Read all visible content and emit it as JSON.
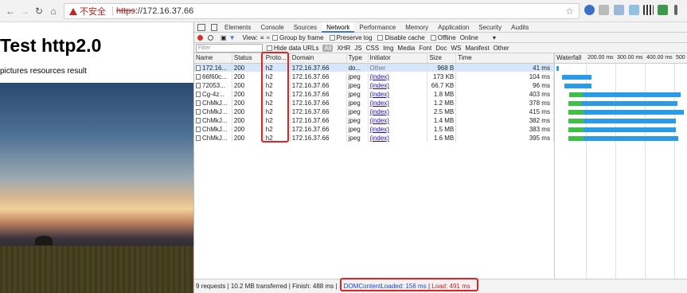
{
  "browser": {
    "warning": "不安全",
    "scheme": "https",
    "host": "://172.16.37.66"
  },
  "page": {
    "heading": "Test http2.0",
    "subtitle": "pictures resources result"
  },
  "devtools": {
    "tabs": [
      "Elements",
      "Console",
      "Sources",
      "Network",
      "Performance",
      "Memory",
      "Application",
      "Security",
      "Audits"
    ],
    "active_tab": "Network",
    "toolbar": {
      "view": "View:",
      "group_by_frame": "Group by frame",
      "preserve_log": "Preserve log",
      "disable_cache": "Disable cache",
      "offline": "Offline",
      "throttle": "Online"
    },
    "filter": {
      "placeholder": "Filter",
      "hide_data_urls": "Hide data URLs",
      "types": [
        "All",
        "XHR",
        "JS",
        "CSS",
        "Img",
        "Media",
        "Font",
        "Doc",
        "WS",
        "Manifest",
        "Other"
      ]
    },
    "columns": [
      "Name",
      "Status",
      "Proto...",
      "Domain",
      "Type",
      "Initiator",
      "Size",
      "Time",
      "Waterfall"
    ],
    "waterfall_ticks": [
      "200.00 ms",
      "300.00 ms",
      "400.00 ms",
      "500"
    ],
    "rows": [
      {
        "name": "172.16...",
        "status": "200",
        "proto": "h2",
        "domain": "172.16.37.66",
        "type": "do...",
        "initiator": "Other",
        "size": "968 B",
        "time": "41 ms",
        "start": 0.0,
        "end": 0.02,
        "green": 0
      },
      {
        "name": "66f60c...",
        "status": "200",
        "proto": "h2",
        "domain": "172.16.37.66",
        "type": "jpeg",
        "initiator": "(index)",
        "size": "173 KB",
        "time": "104 ms",
        "start": 0.04,
        "end": 0.27,
        "green": 0
      },
      {
        "name": "72053...",
        "status": "200",
        "proto": "h2",
        "domain": "172.16.37.66",
        "type": "jpeg",
        "initiator": "(index)",
        "size": "66.7 KB",
        "time": "96 ms",
        "start": 0.06,
        "end": 0.27,
        "green": 0
      },
      {
        "name": "Cg-4z...",
        "status": "200",
        "proto": "h2",
        "domain": "172.16.37.66",
        "type": "jpeg",
        "initiator": "(index)",
        "size": "1.8 MB",
        "time": "403 ms",
        "start": 0.1,
        "end": 0.96,
        "green": 0.1
      },
      {
        "name": "ChMkJ...",
        "status": "200",
        "proto": "h2",
        "domain": "172.16.37.66",
        "type": "jpeg",
        "initiator": "(index)",
        "size": "1.2 MB",
        "time": "378 ms",
        "start": 0.09,
        "end": 0.93,
        "green": 0.1
      },
      {
        "name": "ChMkJ...",
        "status": "200",
        "proto": "h2",
        "domain": "172.16.37.66",
        "type": "jpeg",
        "initiator": "(index)",
        "size": "2.5 MB",
        "time": "415 ms",
        "start": 0.09,
        "end": 0.98,
        "green": 0.12
      },
      {
        "name": "ChMkJ...",
        "status": "200",
        "proto": "h2",
        "domain": "172.16.37.66",
        "type": "jpeg",
        "initiator": "(index)",
        "size": "1.4 MB",
        "time": "382 ms",
        "start": 0.09,
        "end": 0.92,
        "green": 0.12
      },
      {
        "name": "ChMkJ...",
        "status": "200",
        "proto": "h2",
        "domain": "172.16.37.66",
        "type": "jpeg",
        "initiator": "(index)",
        "size": "1.5 MB",
        "time": "383 ms",
        "start": 0.09,
        "end": 0.92,
        "green": 0.12
      },
      {
        "name": "ChMkJ...",
        "status": "200",
        "proto": "h2",
        "domain": "172.16.37.66",
        "type": "jpeg",
        "initiator": "(index)",
        "size": "1.6 MB",
        "time": "395 ms",
        "start": 0.09,
        "end": 0.94,
        "green": 0.12
      }
    ],
    "status": {
      "summary": "9 requests | 10.2 MB transferred | Finish: 488 ms |",
      "dom_loaded": "DOMContentLoaded: 156 ms",
      "load": "Load: 491 ms"
    }
  },
  "colors": {
    "bar_blue": "#2a9be6",
    "bar_green": "#3fbf46",
    "highlight": "#e02424"
  }
}
